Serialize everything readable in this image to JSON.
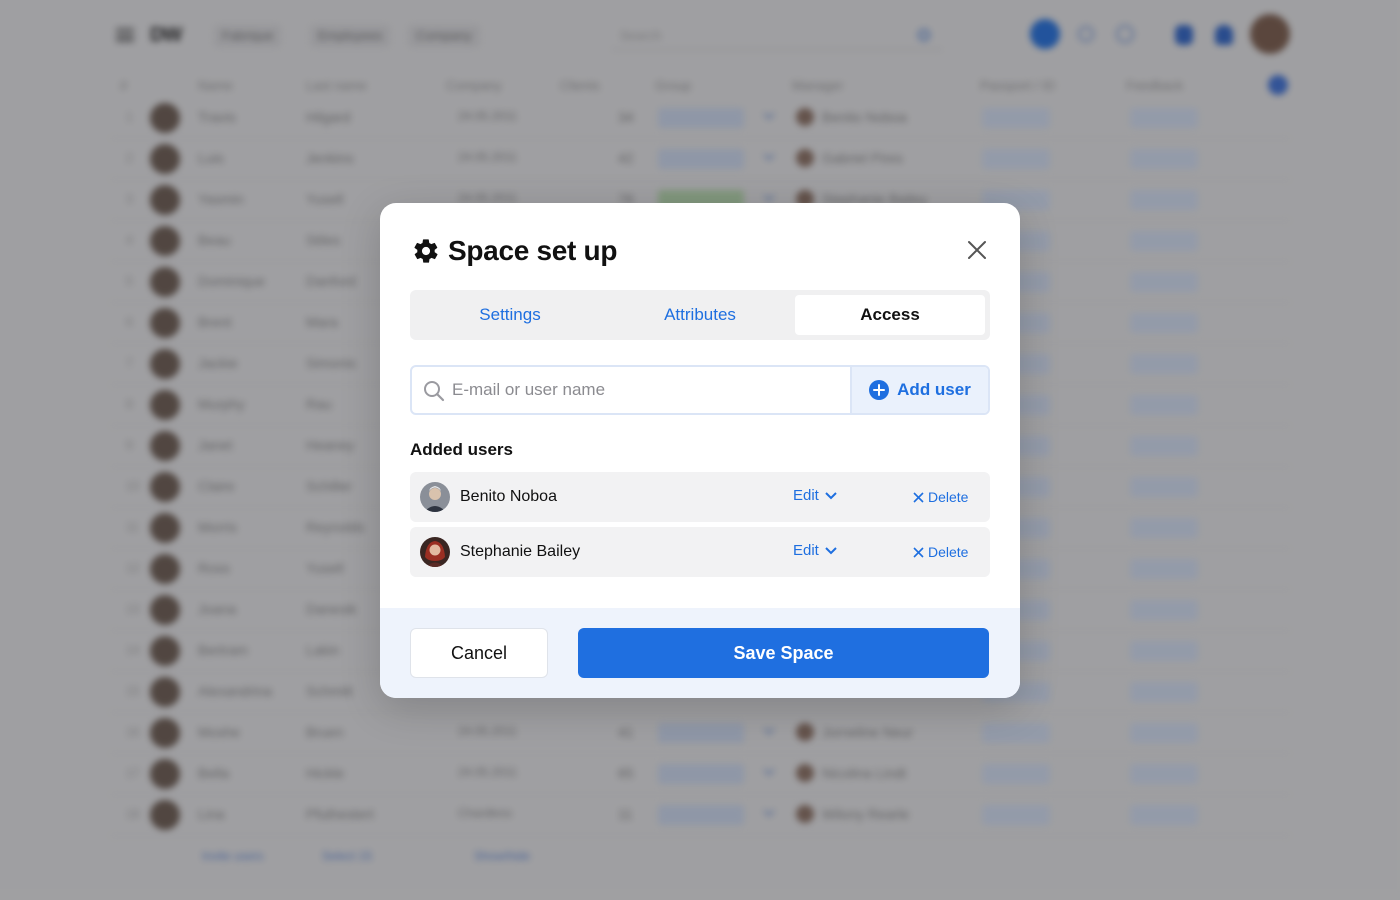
{
  "background": {
    "logo": "DW",
    "top_menu": [
      "Fabrique",
      "Employees",
      "Company"
    ],
    "search_placeholder": "Search",
    "table_headers": [
      "#",
      "Name",
      "Last name",
      "Company",
      "Clients",
      "Group",
      "Manager",
      "Passport / ID",
      "Feedback"
    ],
    "rows": [
      {
        "idx": "1",
        "name": "Travis",
        "last": "Hilgard",
        "date": "24.05.2011",
        "count": "34",
        "green": false,
        "manager": "Benito Noboa"
      },
      {
        "idx": "2",
        "name": "Luis",
        "last": "Jenkins",
        "date": "24.05.2011",
        "count": "42",
        "green": false,
        "manager": "Gabriel Pires"
      },
      {
        "idx": "3",
        "name": "Yasmin",
        "last": "Yusell",
        "date": "24.05.2011",
        "count": "78",
        "green": true,
        "manager": "Stephanie Bailey"
      },
      {
        "idx": "4",
        "name": "Beau",
        "last": "Stiles"
      },
      {
        "idx": "5",
        "name": "Dominique",
        "last": "Danford"
      },
      {
        "idx": "6",
        "name": "Brent",
        "last": "Mara"
      },
      {
        "idx": "7",
        "name": "Jackie",
        "last": "Simonis"
      },
      {
        "idx": "8",
        "name": "Murphy",
        "last": "Rau"
      },
      {
        "idx": "9",
        "name": "Janet",
        "last": "Heaney"
      },
      {
        "idx": "10",
        "name": "Claire",
        "last": "Schiller"
      },
      {
        "idx": "11",
        "name": "Morris",
        "last": "Reynolds"
      },
      {
        "idx": "12",
        "name": "Ross",
        "last": "Yusell"
      },
      {
        "idx": "13",
        "name": "Joana",
        "last": "Danesik"
      },
      {
        "idx": "14",
        "name": "Bertram",
        "last": "Lakin"
      },
      {
        "idx": "15",
        "name": "Alexandrina",
        "last": "Schmitt"
      },
      {
        "idx": "16",
        "name": "Moshe",
        "last": "Bruen",
        "date": "24.05.2011",
        "count": "41",
        "green": false,
        "manager": "Jorneline Neur"
      },
      {
        "idx": "17",
        "name": "Bella",
        "last": "Hickle",
        "date": "24.05.2011",
        "count": "65",
        "green": false,
        "manager": "Nicolina Lindt"
      },
      {
        "idx": "18",
        "name": "Lina",
        "last": "Pfuthestert",
        "date": "Chardless",
        "count": "11",
        "green": false,
        "manager": "Wilony Rearle"
      }
    ],
    "bottom_bar": [
      "Invite users",
      "Select 15",
      "Show/hide"
    ]
  },
  "modal": {
    "title": "Space set up",
    "tabs": [
      "Settings",
      "Attributes",
      "Access"
    ],
    "active_tab": "Access",
    "search_placeholder": "E-mail or user name",
    "add_user_label": "Add user",
    "added_users_heading": "Added users",
    "users": [
      {
        "name": "Benito Noboa",
        "edit_label": "Edit",
        "delete_label": "Delete"
      },
      {
        "name": "Stephanie Bailey",
        "edit_label": "Edit",
        "delete_label": "Delete"
      }
    ],
    "cancel_label": "Cancel",
    "save_label": "Save Space"
  },
  "colors": {
    "accent": "#1f6fe0",
    "footer_bg": "#eef3fc",
    "row_bg": "#f2f2f3"
  }
}
